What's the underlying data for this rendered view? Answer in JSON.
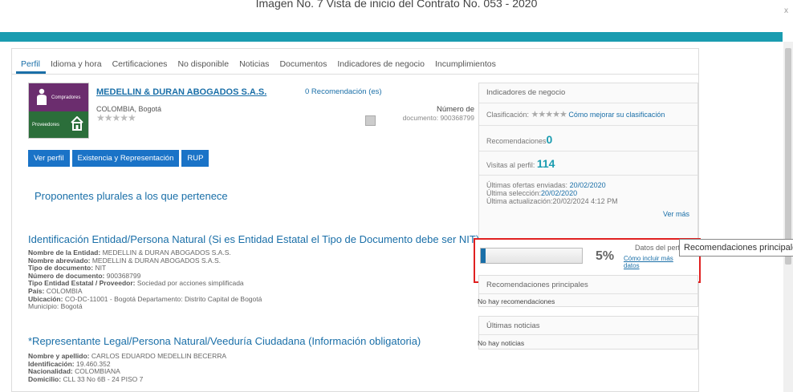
{
  "caption": "Imagen No. 7 Vista de inicio del Contrato No. 053 - 2020",
  "window": {
    "close_label": "x"
  },
  "tabs": [
    {
      "label": "Perfil",
      "active": true
    },
    {
      "label": "Idioma y hora"
    },
    {
      "label": "Certificaciones"
    },
    {
      "label": "No disponible"
    },
    {
      "label": "Noticias"
    },
    {
      "label": "Documentos"
    },
    {
      "label": "Indicadores de negocio"
    },
    {
      "label": "Incumplimientos"
    }
  ],
  "logo": {
    "top_text": "Compradores",
    "bottom_text": "Proveedores"
  },
  "profile": {
    "name": "MEDELLIN & DURAN ABOGADOS S.A.S.",
    "location": "COLOMBIA, Bogotá",
    "stars": "★★★★★",
    "recommendations": "0 Recomendación (es)",
    "doc_label": "Número de",
    "doc_label2": "documento:",
    "doc_number": "900368799"
  },
  "buttons": {
    "ver_perfil": "Ver perfil",
    "existencia": "Existencia y Representación",
    "rup": "RUP"
  },
  "plural_title": "Proponentes plurales a los que pertenece",
  "identification": {
    "title": "Identificación Entidad/Persona Natural (Si es Entidad Estatal el Tipo de Documento debe ser NIT)",
    "fields": [
      {
        "k": "Nombre de la Entidad:",
        "v": "MEDELLIN & DURAN ABOGADOS S.A.S."
      },
      {
        "k": "Nombre abreviado:",
        "v": "MEDELLIN & DURAN ABOGADOS S.A.S."
      },
      {
        "k": "Tipo de documento:",
        "v": "NIT"
      },
      {
        "k": "Número de documento:",
        "v": "900368799"
      },
      {
        "k": "Tipo Entidad Estatal / Proveedor:",
        "v": "Sociedad por acciones simplificada"
      },
      {
        "k": "País:",
        "v": "COLOMBIA"
      },
      {
        "k": "Ubicación:",
        "v": "CO-DC-11001 - Bogotá Departamento: Distrito Capital de Bogotá"
      },
      {
        "k": "Municipio:",
        "v": "Bogotá"
      }
    ]
  },
  "representative": {
    "title": "*Representante Legal/Persona Natural/Veeduría Ciudadana (Información obligatoria)",
    "fields": [
      {
        "k": "Nombre y apellido:",
        "v": "CARLOS EDUARDO MEDELLIN BECERRA"
      },
      {
        "k": "Identificación:",
        "v": "19.460.352"
      },
      {
        "k": "Nacionalidad:",
        "v": "COLOMBIANA"
      },
      {
        "k": "Domicilio:",
        "v": "CLL 33 No 6B - 24 PISO 7"
      }
    ]
  },
  "indicators": {
    "title": "Indicadores de negocio",
    "calificacion_label": "Clasificación:",
    "stars": "★★★★★",
    "improve_link": "Cómo mejorar su clasificación",
    "recomendaciones_label": "Recomendaciones",
    "recomendaciones_value": "0",
    "visitas_label": "Visitas al perfil:",
    "visitas_value": "114",
    "ofertas_label": "Últimas ofertas enviadas:",
    "ofertas_date": "20/02/2020",
    "seleccion_label": "Última selección:",
    "seleccion_date": "20/02/2020",
    "actualizacion": "Última actualización:20/02/2024 4:12 PM",
    "ver_mas": "Ver más"
  },
  "progress": {
    "percent_value": 5,
    "percent_text": "5%",
    "title": "Datos del perfil",
    "link": "Cómo incluir más datos"
  },
  "recommendations_panel": {
    "title": "Recomendaciones principales",
    "empty": "No hay recomendaciones"
  },
  "news_panel": {
    "title": "Últimas noticias",
    "empty": "No hay noticias"
  },
  "tooltip": "Recomendaciones principales",
  "colors": {
    "accent": "#1a9cb0",
    "link": "#1a6fa8",
    "button": "#1a73c7",
    "highlight": "#e02020"
  }
}
